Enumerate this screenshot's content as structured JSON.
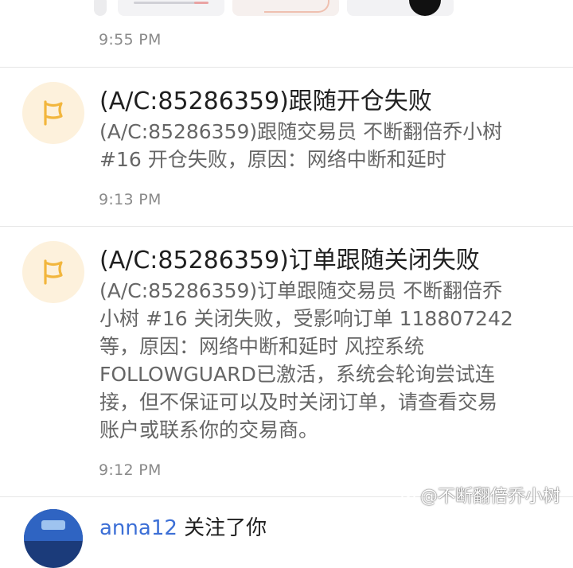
{
  "top_item": {
    "time": "9:55 PM"
  },
  "messages": [
    {
      "icon": "flag-icon",
      "title": "(A/C:85286359)跟随开仓失败",
      "body_lines": [
        "(A/C:85286359)跟随交易员 不断翻倍乔小树",
        "#16 开仓失败，原因：网络中断和延时"
      ],
      "time": "9:13 PM"
    },
    {
      "icon": "flag-icon",
      "title": "(A/C:85286359)订单跟随关闭失败",
      "body_lines": [
        "(A/C:85286359)订单跟随交易员 不断翻倍乔",
        "小树 #16 关闭失败，受影响订单 118807242",
        "等，原因：网络中断和延时 风控系统",
        "FOLLOWGUARD已激活，系统会轮询尝试连",
        "接，但不保证可以及时关闭订单，请查看交易",
        "账户或联系你的交易商。"
      ],
      "time": "9:12 PM"
    }
  ],
  "follow_item": {
    "username": "anna12",
    "action": "关注了你"
  },
  "watermark": {
    "text": "@不断翻倍乔小树"
  },
  "colors": {
    "flag": "#f2b63d",
    "avatar_bg": "#fdf1dc",
    "link": "#3c6fd6"
  }
}
